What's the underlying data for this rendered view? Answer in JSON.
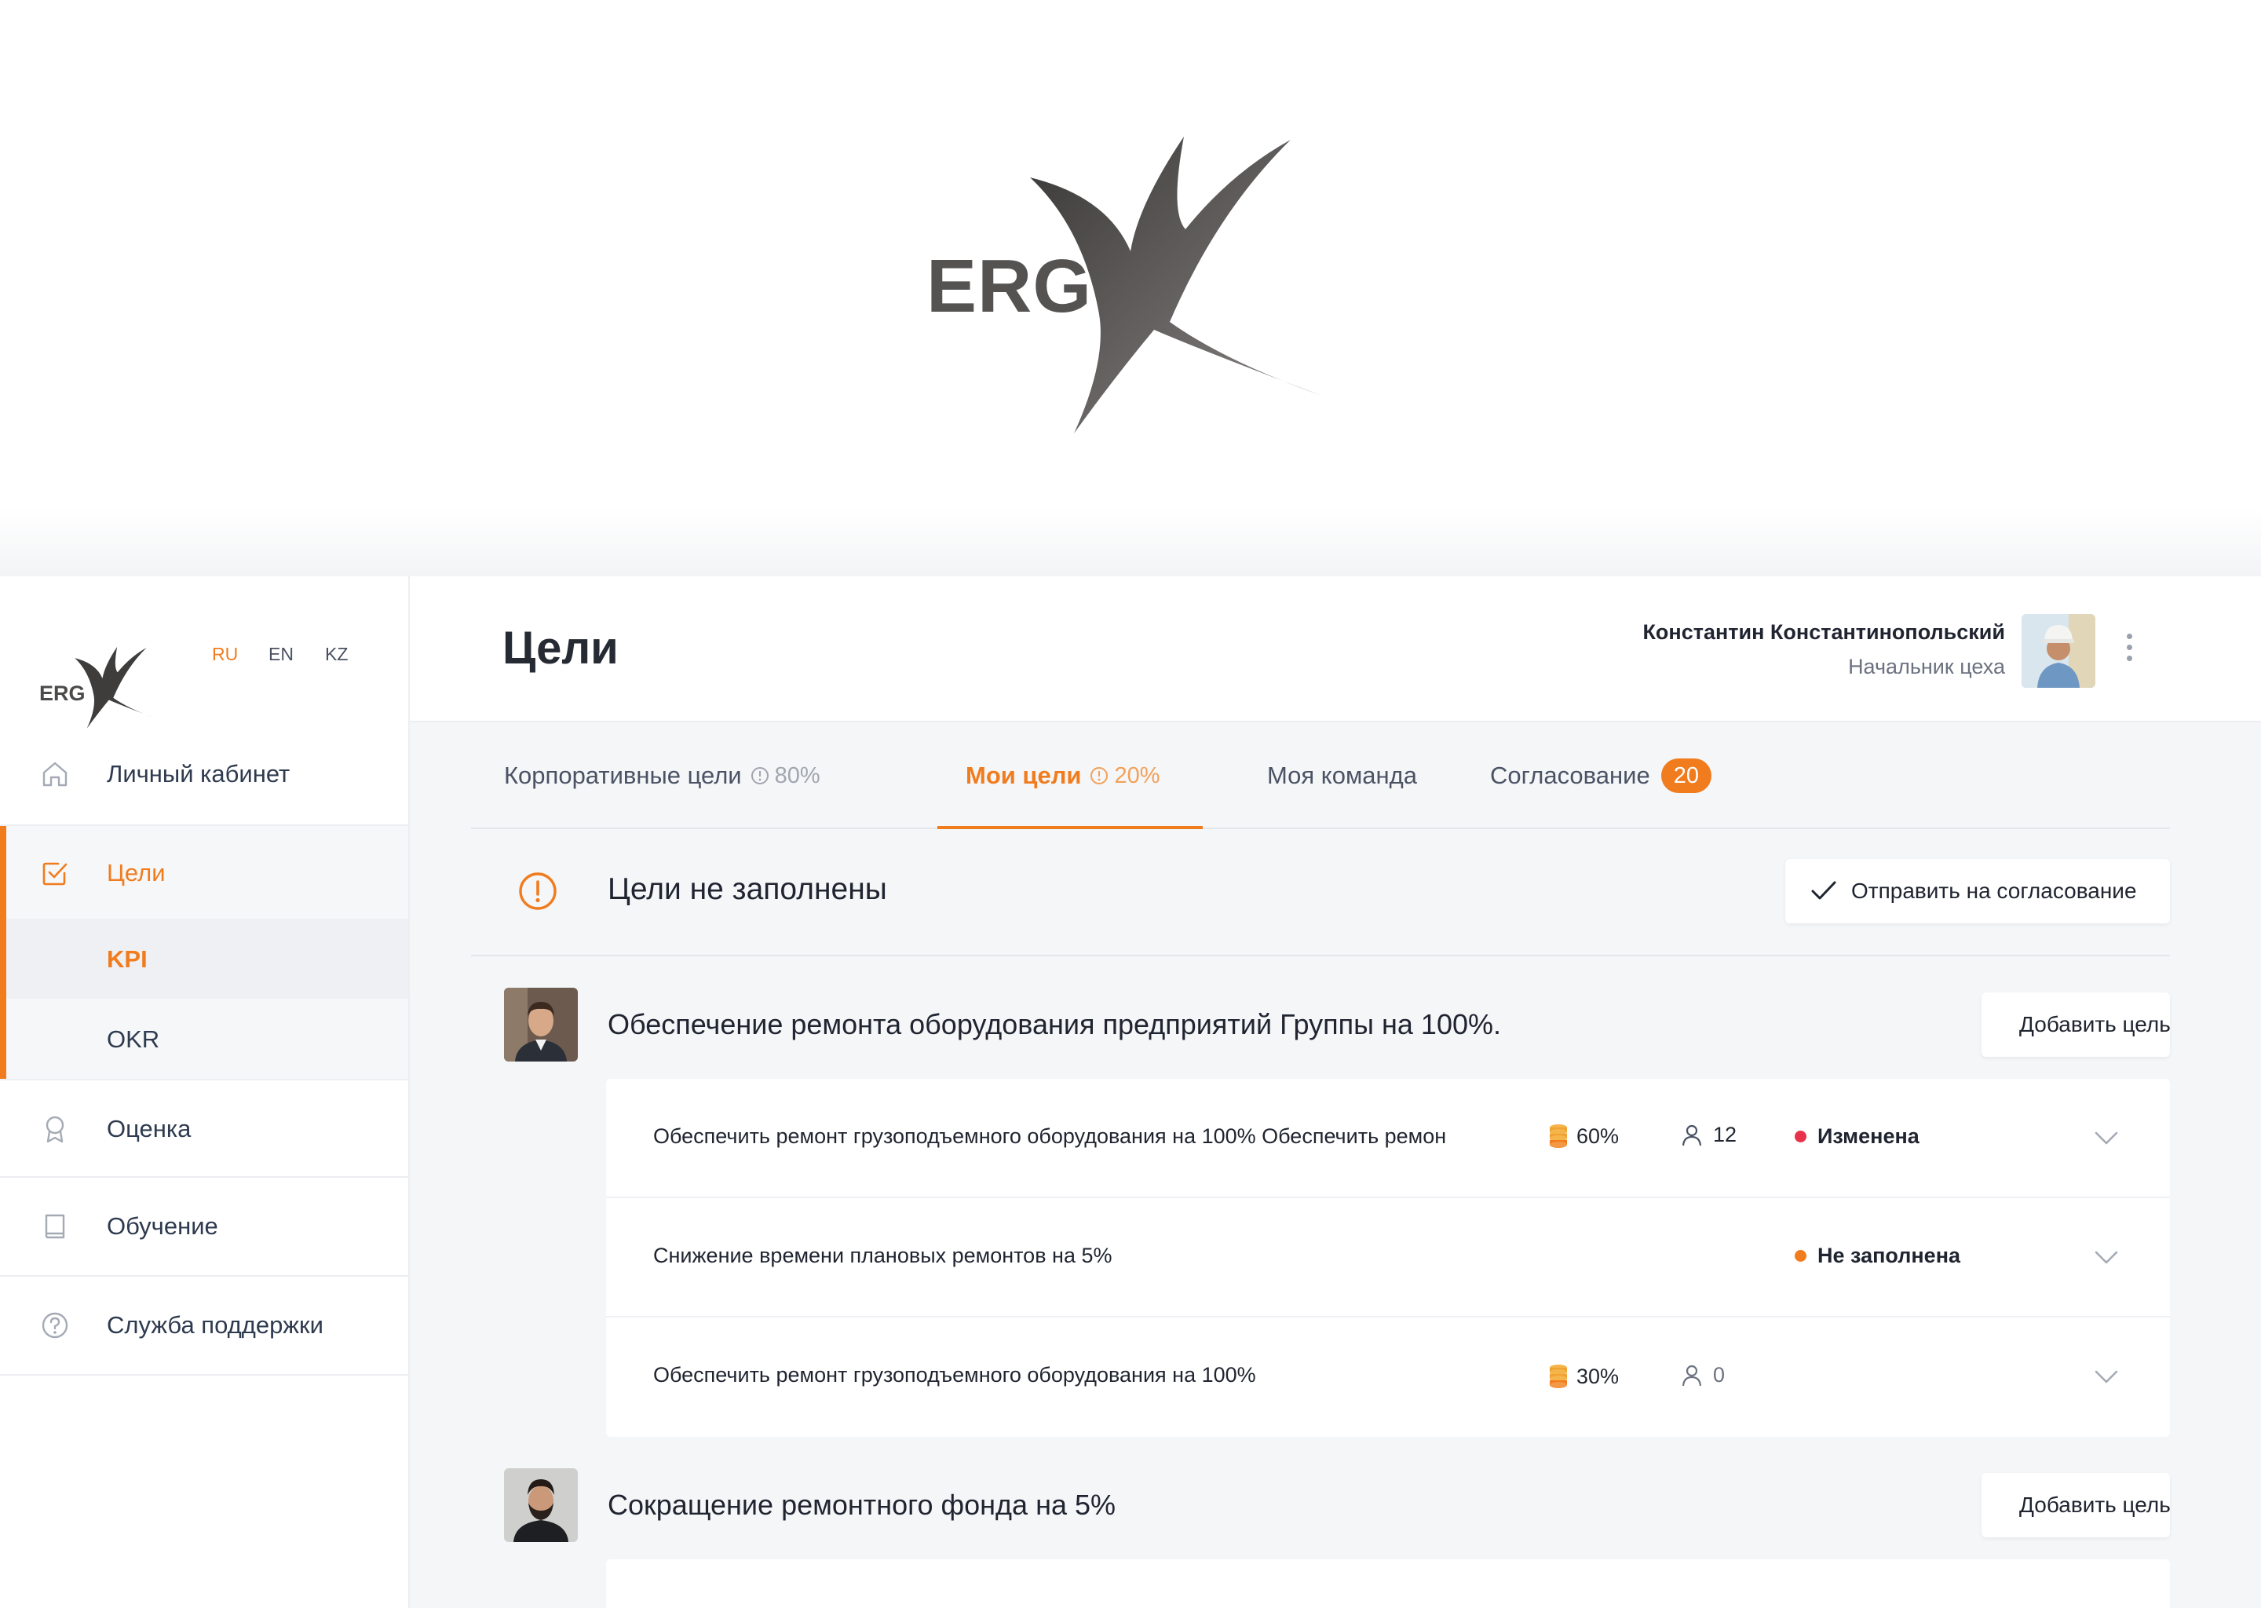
{
  "hero": {
    "brand_text": "ERG"
  },
  "sidebar": {
    "brand_text": "ERG",
    "languages": [
      {
        "code": "RU",
        "active": true
      },
      {
        "code": "EN",
        "active": false
      },
      {
        "code": "KZ",
        "active": false
      }
    ],
    "items": [
      {
        "label": "Личный кабинет",
        "icon": "home-icon"
      },
      {
        "label": "Цели",
        "icon": "checkbox-icon",
        "active": true,
        "children": [
          {
            "label": "KPI",
            "active": true
          },
          {
            "label": "OKR"
          }
        ]
      },
      {
        "label": "Оценка",
        "icon": "award-icon"
      },
      {
        "label": "Обучение",
        "icon": "book-icon"
      },
      {
        "label": "Служба поддержки",
        "icon": "help-icon"
      }
    ]
  },
  "header": {
    "title": "Цели",
    "user_name": "Константин Константинопольский",
    "user_role": "Начальник цеха"
  },
  "tabs": [
    {
      "label": "Корпоративные цели",
      "percent": "80%"
    },
    {
      "label": "Мои цели",
      "percent": "20%",
      "active": true
    },
    {
      "label": "Моя команда"
    },
    {
      "label": "Согласование",
      "badge": "20"
    }
  ],
  "alert": {
    "text": "Цели не заполнены",
    "action_label": "Отправить на согласование"
  },
  "groups": [
    {
      "title": "Обеспечение ремонта оборудования предприятий Группы на 100%.",
      "add_label": "Добавить цель",
      "goals": [
        {
          "title": "Обеспечить ремонт грузоподъемного оборудования на 100% Обеспечить ремон",
          "weight": "60%",
          "people": "12",
          "status": "Изменена",
          "status_color": "#e8324a"
        },
        {
          "title": "Снижение времени плановых ремонтов на 5%",
          "status": "Не заполнена",
          "status_color": "#f07c1e"
        },
        {
          "title": "Обеспечить ремонт грузоподъемного оборудования на 100%",
          "weight": "30%",
          "people": "0"
        }
      ]
    },
    {
      "title": "Сокращение ремонтного фонда на 5%",
      "add_label": "Добавить цель",
      "goals": []
    }
  ],
  "colors": {
    "accent": "#f07c1e",
    "status_changed": "#e8324a",
    "status_empty": "#f07c1e"
  }
}
